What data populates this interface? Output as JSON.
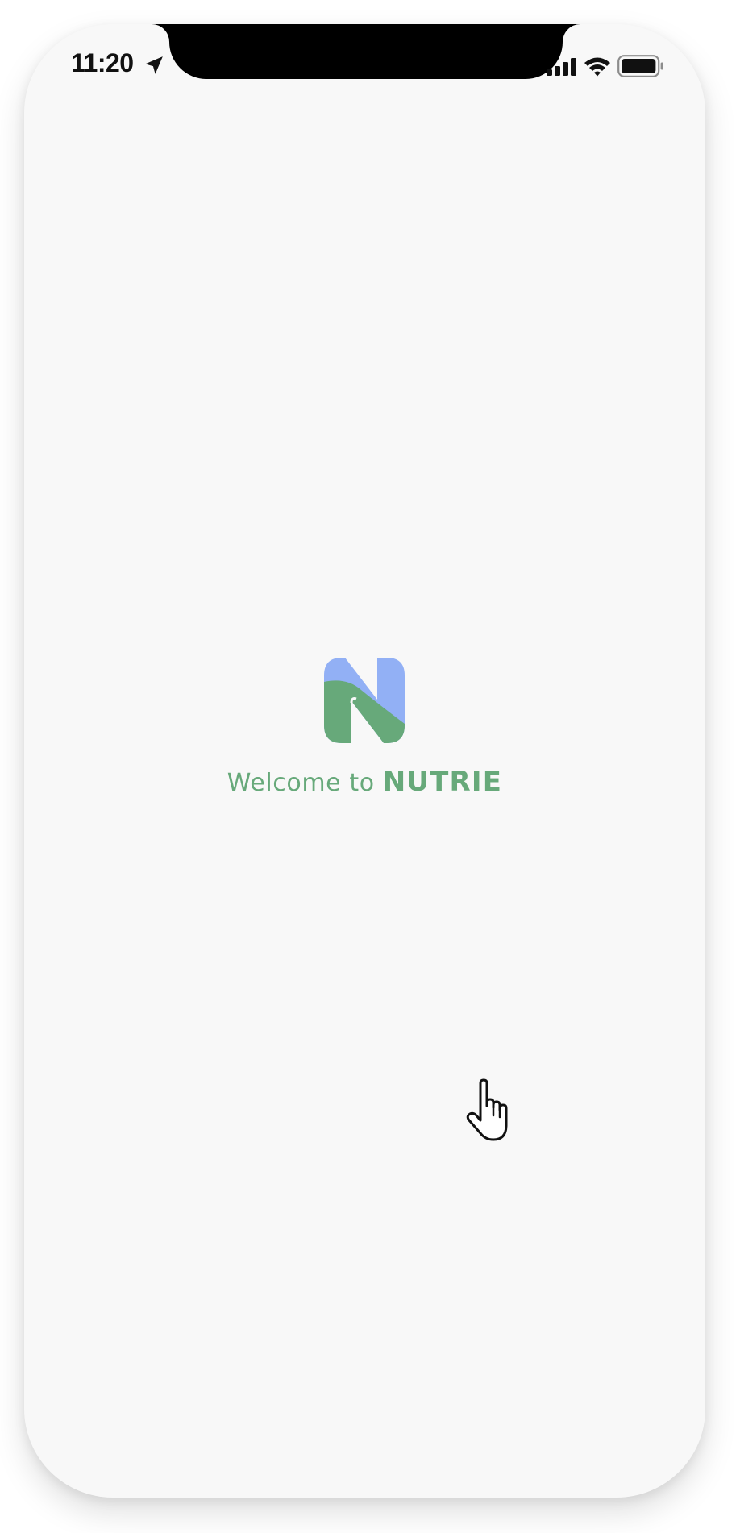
{
  "status_bar": {
    "time": "11:20",
    "icons": [
      "location-arrow-icon",
      "cellular-signal-icon",
      "wifi-icon",
      "battery-icon"
    ]
  },
  "splash": {
    "logo_icon": "nutrie-n-logo",
    "welcome_lead": "Welcome to",
    "app_name": "NUTRIE"
  },
  "pointer": {
    "icon": "hand-pointer-cursor-icon"
  },
  "colors": {
    "background": "#f8f8f8",
    "brand_green": "#67a97a",
    "brand_blue": "#92b0f5",
    "text_dark": "#111111"
  }
}
